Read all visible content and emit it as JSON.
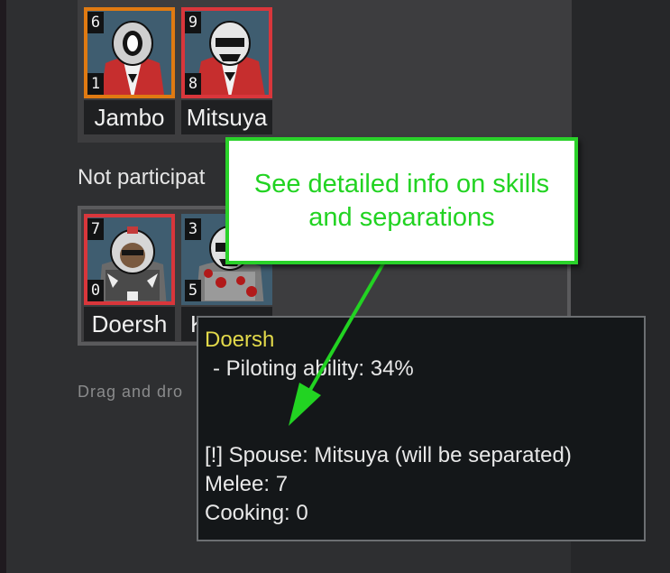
{
  "participating": {
    "pawns": [
      {
        "name": "Jambo",
        "top_badge": "6",
        "bottom_badge": "1",
        "border_color": "#e07a12"
      },
      {
        "name": "Mitsuya",
        "top_badge": "9",
        "bottom_badge": "8",
        "border_color": "#d9363b"
      }
    ]
  },
  "not_participating": {
    "label": "Not participat",
    "pawns": [
      {
        "name": "Doersh",
        "top_badge": "7",
        "bottom_badge": "0",
        "border_color": "#d9363b"
      },
      {
        "name": "K",
        "top_badge": "3",
        "bottom_badge": "5",
        "border_color": "#3f5d70"
      }
    ]
  },
  "drag_hint": "Drag and dro",
  "tooltip": {
    "title": "Doersh",
    "piloting": "- Piloting ability: 34%",
    "spouse": "[!] Spouse: Mitsuya (will be separated)",
    "melee": "Melee: 7",
    "cooking": "Cooking: 0"
  },
  "callout": {
    "line1": "See detailed info on skills",
    "line2": "and separations",
    "color": "#22d322"
  },
  "icons": {
    "pawn_portrait": "pawn-portrait-icon",
    "arrow": "green-arrow-icon"
  }
}
